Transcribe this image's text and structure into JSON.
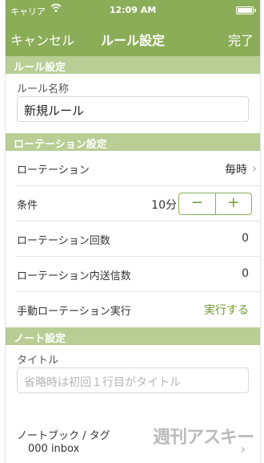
{
  "statusbar": {
    "carrier": "キャリア",
    "time": "12:09 AM"
  },
  "navbar": {
    "cancel": "キャンセル",
    "title": "ルール設定",
    "done": "完了"
  },
  "rule_section": {
    "header": "ルール設定",
    "name_label": "ルール名称",
    "name_value": "新規ルール"
  },
  "rotation_section": {
    "header": "ローテーション設定",
    "rows": {
      "rotation": {
        "label": "ローテーション",
        "value": "毎時"
      },
      "condition": {
        "label": "条件",
        "value": "10分",
        "minus": "−",
        "plus": "+"
      },
      "count": {
        "label": "ローテーション回数",
        "value": "0"
      },
      "inner_send_count": {
        "label": "ローテーション内送信数",
        "value": "0"
      },
      "manual": {
        "label": "手動ローテーション実行",
        "action": "実行する"
      }
    }
  },
  "note_section": {
    "header": "ノート設定",
    "title_label": "タイトル",
    "title_placeholder": "省略時は初回１行目がタイトル",
    "notebook_label": "ノートブック / タグ",
    "notebook_value": "000 inbox"
  },
  "watermark": "週刊アスキー"
}
